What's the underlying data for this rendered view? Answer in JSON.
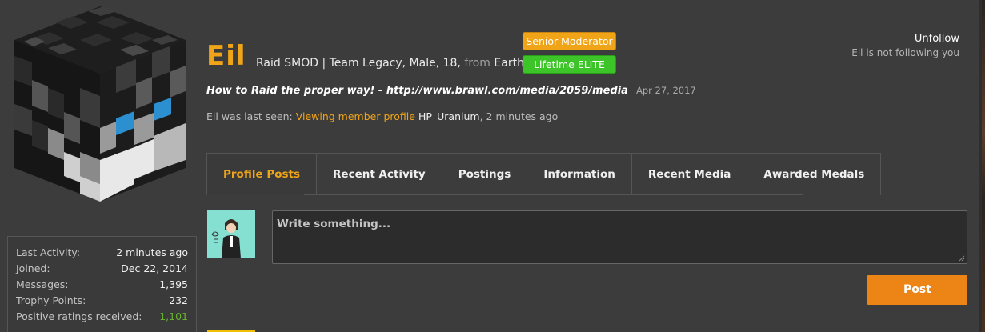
{
  "profile": {
    "username": "Eil",
    "info_text": "Raid SMOD | Team Legacy, Male, 18,",
    "from_label": "from",
    "location": "Earth",
    "badges": [
      "Senior Moderator",
      "Lifetime ELITE"
    ],
    "status_message": "How to Raid the proper way! - http://www.brawl.com/media/2059/media",
    "status_date": "Apr 27, 2017",
    "last_seen_prefix": "Eil was last seen:",
    "last_seen_activity": "Viewing member profile",
    "last_seen_target": "HP_Uranium",
    "last_seen_time": ", 2 minutes ago"
  },
  "follow": {
    "unfollow_label": "Unfollow",
    "not_following_text": "Eil is not following you"
  },
  "tabs": [
    {
      "label": "Profile Posts",
      "active": true
    },
    {
      "label": "Recent Activity"
    },
    {
      "label": "Postings"
    },
    {
      "label": "Information"
    },
    {
      "label": "Recent Media"
    },
    {
      "label": "Awarded Medals"
    }
  ],
  "composer": {
    "placeholder": "Write something...",
    "post_label": "Post"
  },
  "stats": [
    {
      "label": "Last Activity:",
      "value": "2 minutes ago"
    },
    {
      "label": "Joined:",
      "value": "Dec 22, 2014"
    },
    {
      "label": "Messages:",
      "value": "1,395"
    },
    {
      "label": "Trophy Points:",
      "value": "232"
    },
    {
      "label": "Positive ratings received:",
      "value": "1,101"
    }
  ],
  "colors": {
    "accent": "#f0a418",
    "elite": "#3cc428",
    "post_button": "#ec8416",
    "positive": "#66b030"
  }
}
